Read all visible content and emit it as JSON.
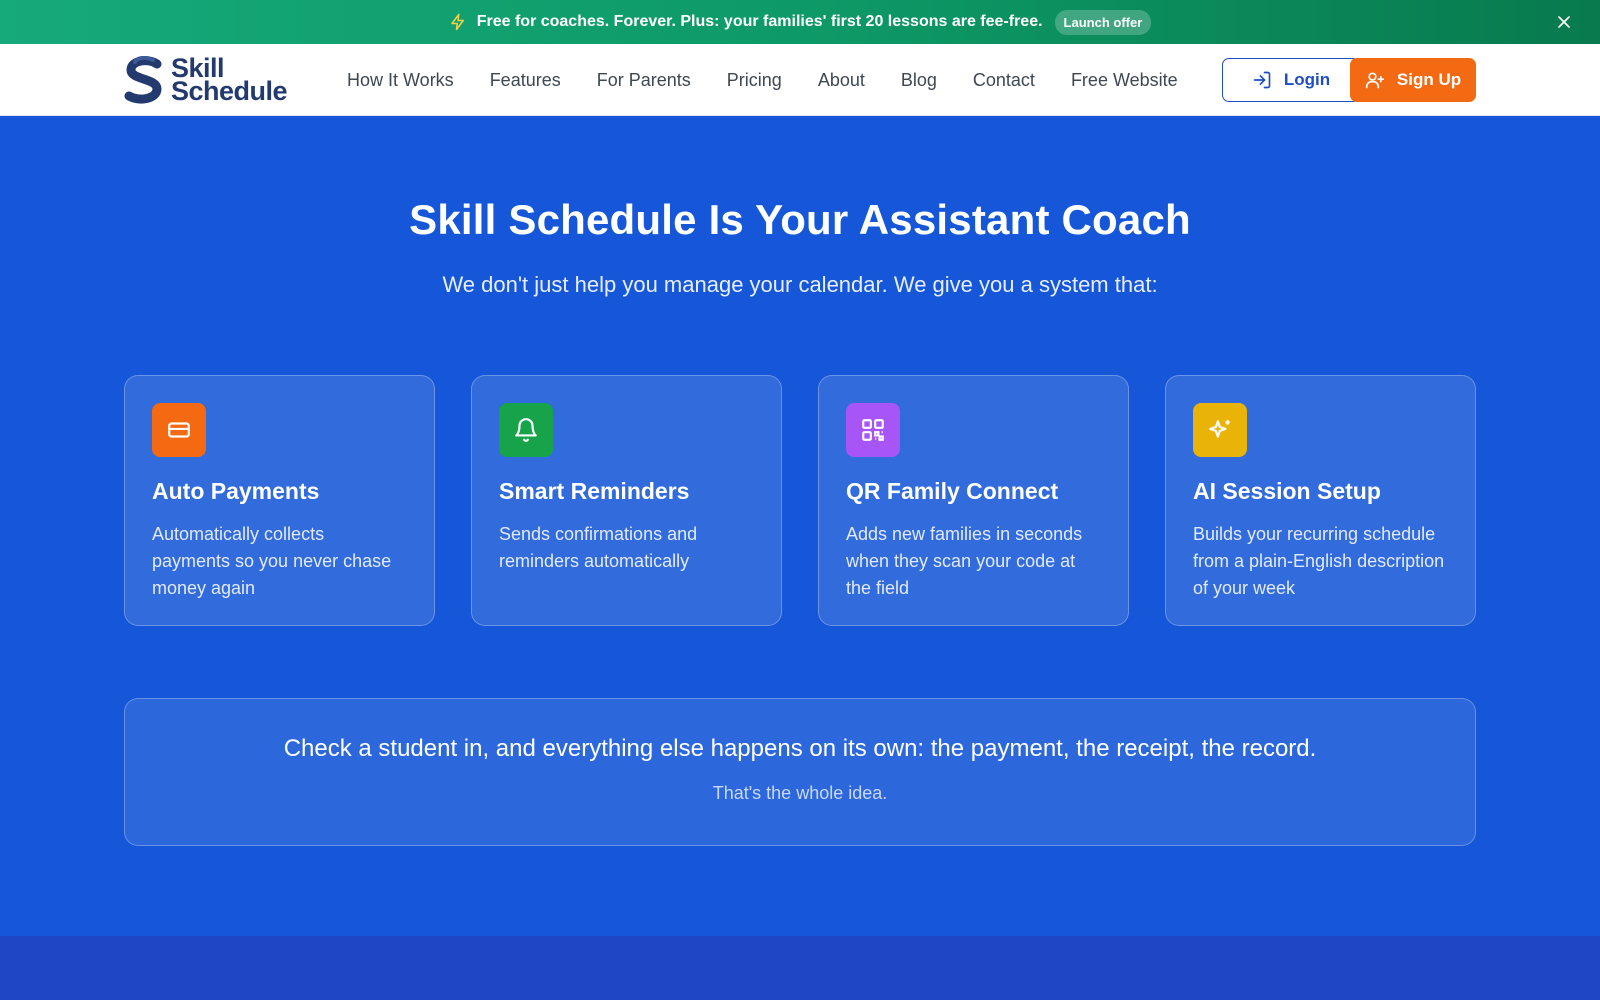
{
  "banner": {
    "text": "Free for coaches. Forever. Plus: your families' first 20 lessons are fee-free.",
    "badge": "Launch offer",
    "icon": "lightning-icon",
    "close_icon": "close-icon"
  },
  "nav": {
    "logo_line1": "Skill",
    "logo_line2": "Schedule",
    "links": [
      "How It Works",
      "Features",
      "For Parents",
      "Pricing",
      "About",
      "Blog",
      "Contact",
      "Free Website"
    ],
    "login_label": "Login",
    "signup_label": "Sign Up"
  },
  "hero": {
    "title": "Skill Schedule Is Your Assistant Coach",
    "subtitle": "We don't just help you manage your calendar. We give you a system that:"
  },
  "features": [
    {
      "title": "Auto Payments",
      "description": "Automatically collects payments so you never chase money again",
      "icon": "credit-card-icon",
      "color": "#f36a12"
    },
    {
      "title": "Smart Reminders",
      "description": "Sends confirmations and reminders automatically",
      "icon": "bell-icon",
      "color": "#16a34a"
    },
    {
      "title": "QR Family Connect",
      "description": "Adds new families in seconds when they scan your code at the field",
      "icon": "qr-code-icon",
      "color": "#a855f7"
    },
    {
      "title": "AI Session Setup",
      "description": "Builds your recurring schedule from a plain-English description of your week",
      "icon": "sparkles-icon",
      "color": "#eab308"
    }
  ],
  "callout": {
    "main": "Check a student in, and everything else happens on its own: the payment, the receipt, the record.",
    "sub": "That's the whole idea."
  },
  "colors": {
    "hero_bg": "#1557d8",
    "banner_green": "#0e9a68",
    "accent_orange": "#f36a12",
    "brand_navy": "#233a6e"
  }
}
